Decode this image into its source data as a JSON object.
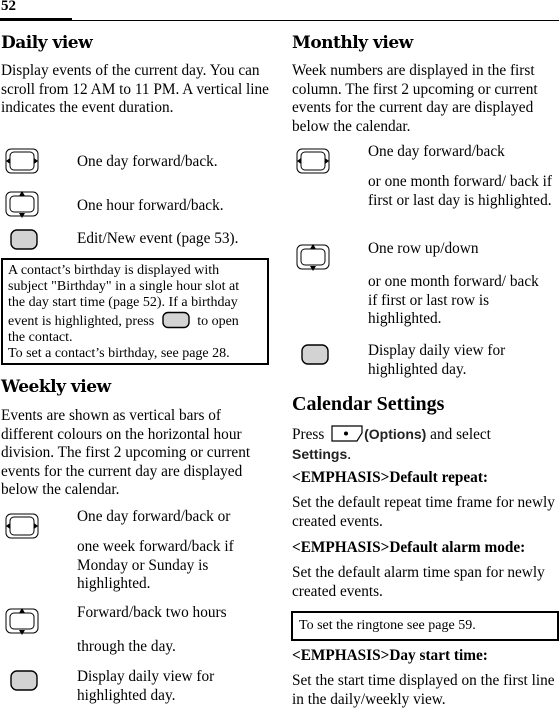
{
  "page": {
    "number": "52"
  },
  "left": {
    "daily": {
      "title": "Daily view",
      "description": "Display events of the current day. You can scroll from 12 AM to 11 PM. A vertical line indicates the event duration.",
      "keys": [
        {
          "icon": "nav-left-right-icon",
          "lines": [
            "One day forward/back."
          ]
        },
        {
          "icon": "nav-up-down-icon",
          "lines": [
            "One hour forward/back."
          ]
        },
        {
          "icon": "select-key-icon",
          "lines": [
            "Edit/New event (page 53)."
          ]
        }
      ],
      "note": {
        "line1": "A contact’s birthday is displayed with",
        "line2": "subject \"Birthday\" in a single hour slot at",
        "line3": "the day start time (page 52). If a birthday",
        "line4_before": "event is highlighted, press",
        "line4_after": "to open",
        "line5": "the contact.",
        "line6": "To set a contact’s birthday, see page 28."
      }
    },
    "weekly": {
      "title": "Weekly view",
      "description": "Events are shown as vertical bars of different colours on the horizontal hour division. The first 2 upcoming or current events for the current day are displayed below the calendar.",
      "keys": [
        {
          "icon": "nav-left-right-icon",
          "lines": [
            "One day forward/back or",
            "one week forward/back if Monday or Sunday is highlighted."
          ]
        },
        {
          "icon": "nav-up-down-icon",
          "lines": [
            "Forward/back two hours",
            "through the day."
          ]
        },
        {
          "icon": "select-key-icon",
          "lines": [
            "Display daily view for highlighted day."
          ]
        }
      ]
    }
  },
  "right": {
    "monthly": {
      "title": "Monthly view",
      "description": "Week numbers are displayed in the first column. The first 2 upcoming or current events for the current day are displayed below the calendar.",
      "keys": [
        {
          "icon": "nav-left-right-icon",
          "lines": [
            "One day forward/back",
            "or one month forward/ back if first or last day is highlighted."
          ]
        },
        {
          "icon": "nav-up-down-icon",
          "lines": [
            "One row up/down",
            "or one month forward/ back if first or last row is highlighted."
          ]
        },
        {
          "icon": "select-key-icon",
          "lines": [
            "Display daily view for highlighted day."
          ]
        }
      ]
    },
    "settings": {
      "title": "Calendar Settings",
      "press_prefix": "Press",
      "options_label": "(Options)",
      "press_suffix": " and select",
      "settings_label": "Settings",
      "period": ".",
      "items": [
        {
          "heading": "<EMPHASIS>Default repeat:",
          "text": "Set the default repeat time frame for newly created events."
        },
        {
          "heading": "<EMPHASIS>Default alarm mode:",
          "text": "Set the default alarm time span for newly created events."
        },
        {
          "heading": "<EMPHASIS>Day start time:",
          "text": "Set the start time displayed on the first line in the daily/weekly view."
        }
      ],
      "ringtone_note": "To set the ringtone see page 59."
    }
  }
}
